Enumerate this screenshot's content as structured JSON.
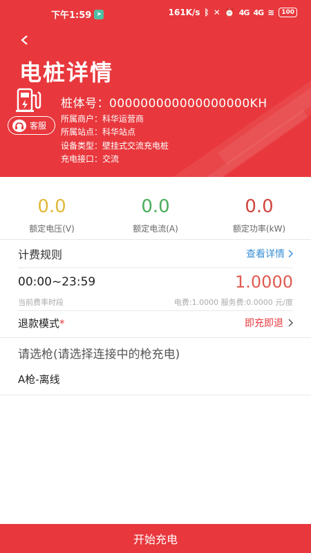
{
  "status_bar": {
    "time": "下午1:59",
    "speed": "161K/s",
    "signal1": "4G",
    "signal2": "4G",
    "battery": "100"
  },
  "header": {
    "title": "电桩详情",
    "pile_no_label": "桩体号：",
    "pile_no": "000000000000000000KH",
    "service_label": "客服",
    "merchant_label": "所属商户：",
    "merchant": "科华运营商",
    "station_label": "所属站点：",
    "station": "科华站点",
    "device_type_label": "设备类型：",
    "device_type": "壁挂式交流充电桩",
    "port_label": "充电接口：",
    "port": "交流"
  },
  "stats": [
    {
      "value": "0.0",
      "label": "额定电压(V)",
      "color": "#e0b93a"
    },
    {
      "value": "0.0",
      "label": "额定电流(A)",
      "color": "#4aad5b"
    },
    {
      "value": "0.0",
      "label": "额定功率(kW)",
      "color": "#d0453f"
    }
  ],
  "billing": {
    "title": "计费规则",
    "detail_link": "查看详情",
    "time_range": "00:00~23:59",
    "price": "1.0000",
    "period_label": "当前费率时段",
    "fee_detail": "电费:1.0000 服务费:0.0000 元/度"
  },
  "refund": {
    "label": "退款模式",
    "required_mark": "*",
    "value": "即充即退"
  },
  "gun": {
    "title": "请选枪(请选择连接中的枪充电)",
    "items": [
      "A枪-离线"
    ]
  },
  "start_button": "开始充电",
  "colors": {
    "brand_red": "#e8383d",
    "link_blue": "#3a8fd6"
  }
}
